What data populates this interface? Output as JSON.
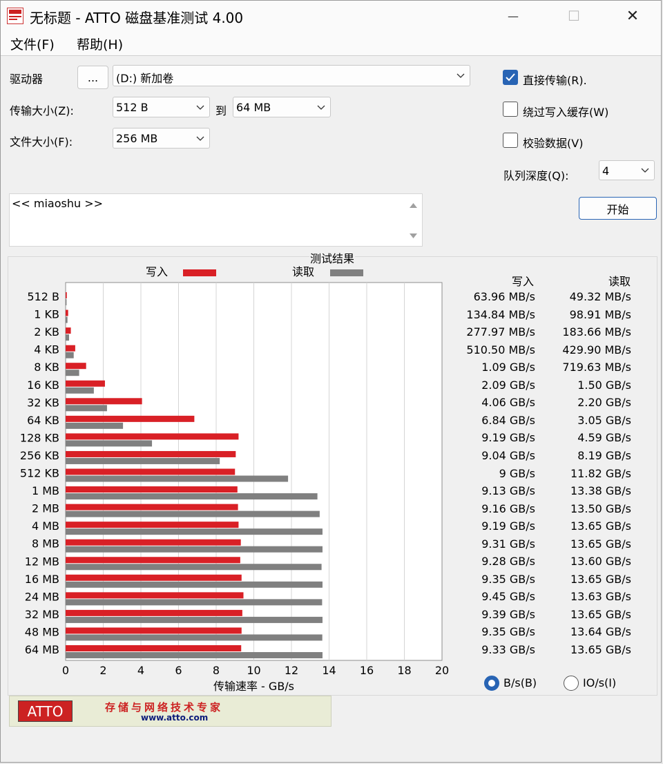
{
  "window": {
    "title": "无标题 - ATTO 磁盘基准测试 4.00",
    "minimize": "—",
    "maximize": "☐",
    "close": "✕"
  },
  "menu": {
    "file": "文件(F)",
    "help": "帮助(H)"
  },
  "drive": {
    "label": "驱动器",
    "browse": "...",
    "value": "(D:) 新加卷"
  },
  "transfer": {
    "label": "传输大小(Z):",
    "from": "512 B",
    "to_label": "到",
    "to": "64 MB"
  },
  "file_size": {
    "label": "文件大小(F):",
    "value": "256 MB"
  },
  "options": {
    "direct": {
      "label": "直接传输(R).",
      "checked": true
    },
    "bypass": {
      "label": "绕过写入缓存(W)",
      "checked": false
    },
    "verify": {
      "label": "校验数据(V)",
      "checked": false
    },
    "queue_label": "队列深度(Q):",
    "queue_value": "4",
    "start": "开始"
  },
  "description": "<< miaoshu >>",
  "results": {
    "title": "测试结果",
    "write_header": "写入",
    "read_header": "读取",
    "rows": [
      {
        "write": "63.96 MB/s",
        "read": "49.32 MB/s"
      },
      {
        "write": "134.84 MB/s",
        "read": "98.91 MB/s"
      },
      {
        "write": "277.97 MB/s",
        "read": "183.66 MB/s"
      },
      {
        "write": "510.50 MB/s",
        "read": "429.90 MB/s"
      },
      {
        "write": "1.09 GB/s",
        "read": "719.63 MB/s"
      },
      {
        "write": "2.09 GB/s",
        "read": "1.50 GB/s"
      },
      {
        "write": "4.06 GB/s",
        "read": "2.20 GB/s"
      },
      {
        "write": "6.84 GB/s",
        "read": "3.05 GB/s"
      },
      {
        "write": "9.19 GB/s",
        "read": "4.59 GB/s"
      },
      {
        "write": "9.04 GB/s",
        "read": "8.19 GB/s"
      },
      {
        "write": "9 GB/s",
        "read": "11.82 GB/s"
      },
      {
        "write": "9.13 GB/s",
        "read": "13.38 GB/s"
      },
      {
        "write": "9.16 GB/s",
        "read": "13.50 GB/s"
      },
      {
        "write": "9.19 GB/s",
        "read": "13.65 GB/s"
      },
      {
        "write": "9.31 GB/s",
        "read": "13.65 GB/s"
      },
      {
        "write": "9.28 GB/s",
        "read": "13.60 GB/s"
      },
      {
        "write": "9.35 GB/s",
        "read": "13.65 GB/s"
      },
      {
        "write": "9.45 GB/s",
        "read": "13.63 GB/s"
      },
      {
        "write": "9.39 GB/s",
        "read": "13.65 GB/s"
      },
      {
        "write": "9.35 GB/s",
        "read": "13.64 GB/s"
      },
      {
        "write": "9.33 GB/s",
        "read": "13.65 GB/s"
      }
    ]
  },
  "units": {
    "bytes": "B/s(B)",
    "io": "IO/s(I)",
    "selected": "bytes"
  },
  "footer": {
    "logo": "ATTO",
    "slogan": "存储与网络技术专家",
    "url": "www.atto.com"
  },
  "chart_data": {
    "type": "bar",
    "orientation": "horizontal",
    "title": "测试结果",
    "xlabel": "传输速率 - GB/s",
    "ylabel": "",
    "xlim": [
      0,
      20
    ],
    "xticks": [
      0,
      2,
      4,
      6,
      8,
      10,
      12,
      14,
      16,
      18,
      20
    ],
    "grid": true,
    "legend_position": "top",
    "categories": [
      "512 B",
      "1 KB",
      "2 KB",
      "4 KB",
      "8 KB",
      "16 KB",
      "32 KB",
      "64 KB",
      "128 KB",
      "256 KB",
      "512 KB",
      "1 MB",
      "2 MB",
      "4 MB",
      "8 MB",
      "12 MB",
      "16 MB",
      "24 MB",
      "32 MB",
      "48 MB",
      "64 MB"
    ],
    "series": [
      {
        "name": "写入",
        "color": "#d92026",
        "values": [
          0.06396,
          0.13484,
          0.27797,
          0.5105,
          1.09,
          2.09,
          4.06,
          6.84,
          9.19,
          9.04,
          9.0,
          9.13,
          9.16,
          9.19,
          9.31,
          9.28,
          9.35,
          9.45,
          9.39,
          9.35,
          9.33
        ]
      },
      {
        "name": "读取",
        "color": "#808080",
        "values": [
          0.04932,
          0.09891,
          0.18366,
          0.4299,
          0.71963,
          1.5,
          2.2,
          3.05,
          4.59,
          8.19,
          11.82,
          13.38,
          13.5,
          13.65,
          13.65,
          13.6,
          13.65,
          13.63,
          13.65,
          13.64,
          13.65
        ]
      }
    ]
  }
}
